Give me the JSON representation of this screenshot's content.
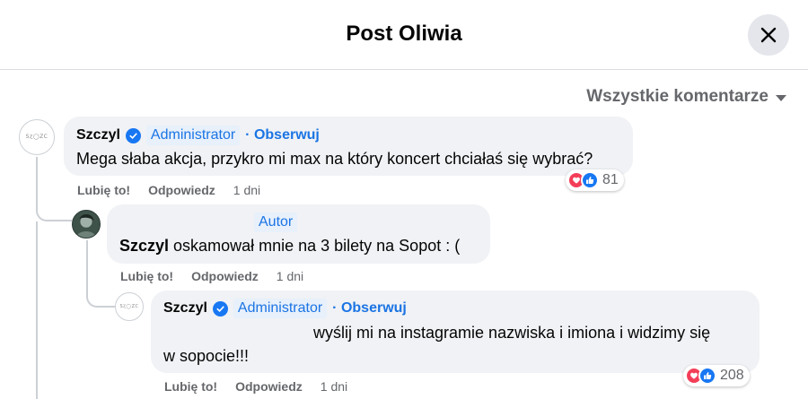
{
  "dialog": {
    "title": "Post Oliwia"
  },
  "filter": {
    "label": "Wszystkie komentarze"
  },
  "comments": [
    {
      "author": "Szczyl",
      "role_badge": "Administrator",
      "follow": "· Obserwuj",
      "text": "Mega słaba akcja, przykro mi max na który koncert chciałaś się wybrać?",
      "actions": {
        "like": "Lubię to!",
        "reply": "Odpowiedz",
        "time": "1 dni"
      },
      "reactions": {
        "count": "81"
      }
    },
    {
      "author": "Szczyl",
      "role_badge": "Autor",
      "text": "oskamował mnie na 3 bilety na Sopot : (",
      "actions": {
        "like": "Lubię to!",
        "reply": "Odpowiedz",
        "time": "1 dni"
      }
    },
    {
      "author": "Szczyl",
      "role_badge": "Administrator",
      "follow": "· Obserwuj",
      "text_line1": "wyślij mi na instagramie nazwiska i imiona i widzimy się",
      "text_line2": "w sopocie!!!",
      "actions": {
        "like": "Lubię to!",
        "reply": "Odpowiedz",
        "time": "1 dni"
      },
      "reactions": {
        "count": "208"
      }
    }
  ],
  "colors": {
    "accent": "#1b74e4",
    "love": "#f33e58",
    "like": "#1877f2",
    "bubble": "#f0f2f5"
  }
}
